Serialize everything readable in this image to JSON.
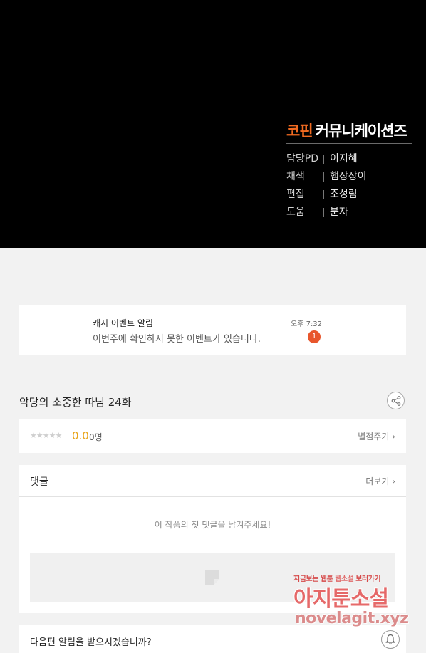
{
  "credits": {
    "studio_brand": "코핀",
    "studio_rest": "커뮤니케이션즈",
    "rows": [
      {
        "role": "담당PD",
        "name": "이지혜"
      },
      {
        "role": "채색",
        "name": "햄장장이"
      },
      {
        "role": "편집",
        "name": "조성림"
      },
      {
        "role": "도움",
        "name": "분자"
      }
    ]
  },
  "notice": {
    "title": "캐시 이벤트 알림",
    "body": "이번주에 확인하지 못한 이벤트가 있습니다.",
    "time": "오후 7:32",
    "badge": "1"
  },
  "episode": {
    "title": "악당의 소중한 따님 24화"
  },
  "rating": {
    "stars": "★★★★★",
    "score": "0.0",
    "count": "0명",
    "rate_button": "별점주기 ›"
  },
  "comments": {
    "title": "댓글",
    "more_button": "더보기 ›",
    "empty_message": "이 작품의 첫 댓글을 남겨주세요!"
  },
  "subscribe": {
    "text": "다음편 알림을 받으시겠습니까?"
  },
  "watermark": {
    "top_left": "지금보는 웹툰",
    "top_mid": "웹소설",
    "top_right": "보러가기",
    "main": "아지툰소설",
    "url": "novelagit.xyz"
  },
  "colors": {
    "brand": "#f26b21",
    "score": "#e8a317",
    "badge": "#e8562c"
  }
}
